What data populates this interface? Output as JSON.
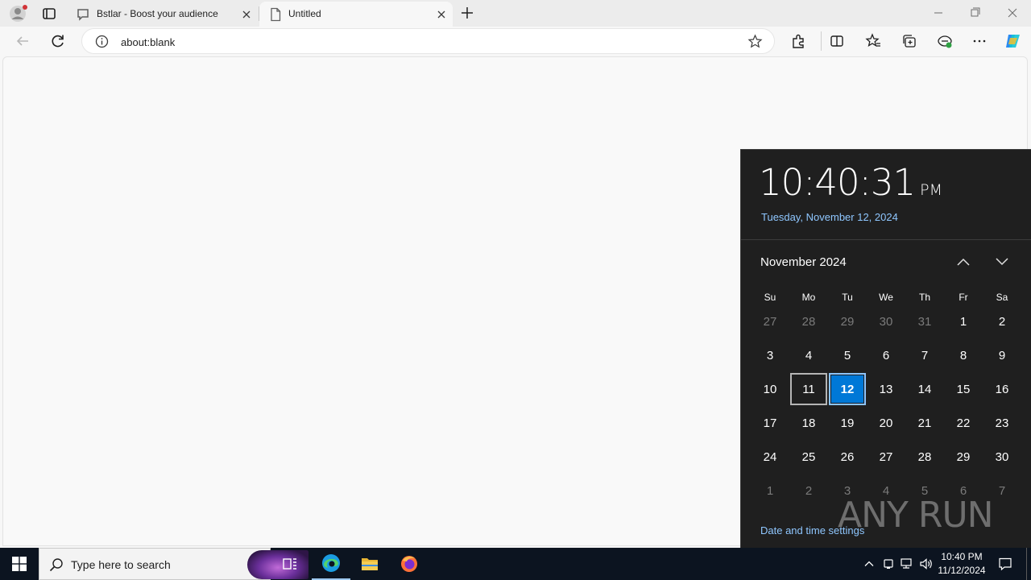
{
  "browser": {
    "tabs": [
      {
        "title": "Bstlar - Boost your audience",
        "active": false
      },
      {
        "title": "Untitled",
        "active": true
      }
    ],
    "address": "about:blank"
  },
  "flyout": {
    "time": "10:40:31",
    "ampm": "PM",
    "long_date": "Tuesday, November 12, 2024",
    "month_title": "November 2024",
    "weekdays": [
      "Su",
      "Mo",
      "Tu",
      "We",
      "Th",
      "Fr",
      "Sa"
    ],
    "weeks": [
      [
        "27",
        "28",
        "29",
        "30",
        "31",
        "1",
        "2"
      ],
      [
        "3",
        "4",
        "5",
        "6",
        "7",
        "8",
        "9"
      ],
      [
        "10",
        "11",
        "12",
        "13",
        "14",
        "15",
        "16"
      ],
      [
        "17",
        "18",
        "19",
        "20",
        "21",
        "22",
        "23"
      ],
      [
        "24",
        "25",
        "26",
        "27",
        "28",
        "29",
        "30"
      ],
      [
        "1",
        "2",
        "3",
        "4",
        "5",
        "6",
        "7"
      ]
    ],
    "settings_link": "Date and time settings",
    "watermark": "ANY RUN"
  },
  "taskbar": {
    "search_placeholder": "Type here to search",
    "clock_time": "10:40 PM",
    "clock_date": "11/12/2024"
  },
  "colors": {
    "accent": "#0078d7",
    "link": "#8fc7ff",
    "taskbar": "#0c1420",
    "flyout": "#1f1f1f"
  }
}
